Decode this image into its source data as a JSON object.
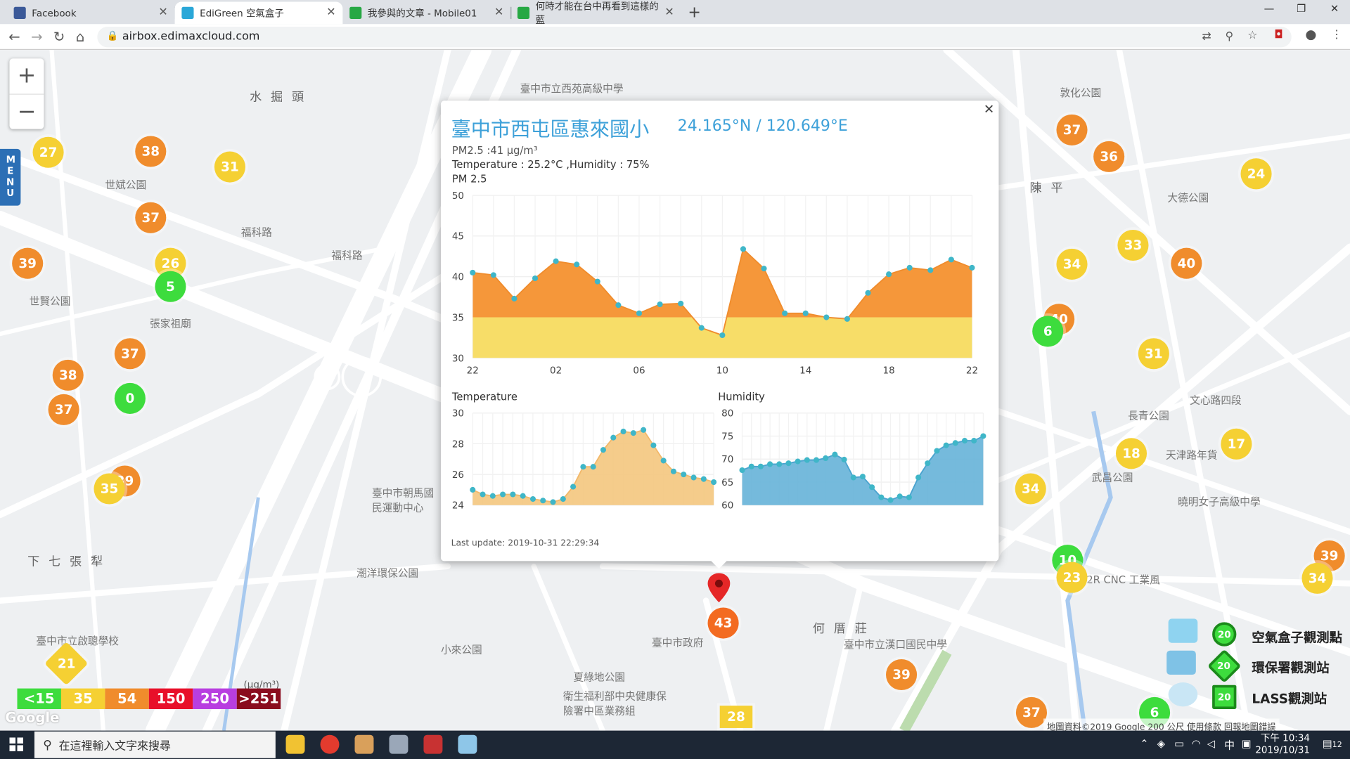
{
  "browser": {
    "tabs": [
      {
        "label": "Facebook",
        "color": "#3b5998",
        "active": false
      },
      {
        "label": "EdiGreen 空氣盒子",
        "color": "#2aa7d8",
        "active": true
      },
      {
        "label": "我參與的文章 - Mobile01",
        "color": "#27a844",
        "active": false
      },
      {
        "label": "何時才能在台中再看到這樣的藍",
        "color": "#27a844",
        "active": false
      }
    ],
    "url": "airbox.edimaxcloud.com"
  },
  "map": {
    "labels": [
      "水 掘 頭",
      "世賢公園",
      "世斌公園",
      "張家祖廟",
      "福科路",
      "福科路",
      "下 七 張 犁",
      "潮洋環保公園",
      "臺中市政府",
      "何 厝 莊",
      "臺中市立漢口國民中學",
      "夏綠地公園",
      "小來公園",
      "陳 平",
      "敦化公園",
      "大德公園",
      "長青公園",
      "天津路年貨",
      "曉明女子高級中學",
      "2R CNC 工業風",
      "武昌公園",
      "文心路四段",
      "臺中市立西苑高級中學",
      "臺中市朝馬國民運動中心",
      "臺中市立啟聰學校",
      "衛生福利部中央健康保險署中區業務組"
    ],
    "stations": [
      {
        "value": "27",
        "c": "y"
      },
      {
        "value": "38",
        "c": "o"
      },
      {
        "value": "31",
        "c": "y"
      },
      {
        "value": "37",
        "c": "o"
      },
      {
        "value": "39",
        "c": "o"
      },
      {
        "value": "26",
        "c": "y"
      },
      {
        "value": "5",
        "c": "g"
      },
      {
        "value": "37",
        "c": "o"
      },
      {
        "value": "38",
        "c": "o"
      },
      {
        "value": "37",
        "c": "o"
      },
      {
        "value": "0",
        "c": "g"
      },
      {
        "value": "39",
        "c": "o"
      },
      {
        "value": "35",
        "c": "y"
      },
      {
        "value": "37",
        "c": "o"
      },
      {
        "value": "36",
        "c": "o"
      },
      {
        "value": "24",
        "c": "y"
      },
      {
        "value": "33",
        "c": "y"
      },
      {
        "value": "34",
        "c": "y"
      },
      {
        "value": "40",
        "c": "o"
      },
      {
        "value": "40",
        "c": "o"
      },
      {
        "value": "6",
        "c": "g"
      },
      {
        "value": "31",
        "c": "y"
      },
      {
        "value": "17",
        "c": "y"
      },
      {
        "value": "18",
        "c": "y"
      },
      {
        "value": "34",
        "c": "y"
      },
      {
        "value": "10",
        "c": "g"
      },
      {
        "value": "23",
        "c": "y"
      },
      {
        "value": "39",
        "c": "o"
      },
      {
        "value": "34",
        "c": "y"
      },
      {
        "value": "43",
        "c": "o"
      },
      {
        "value": "39",
        "c": "o"
      },
      {
        "value": "37",
        "c": "o"
      },
      {
        "value": "6",
        "c": "g"
      },
      {
        "value": "21",
        "c": "y"
      },
      {
        "value": "28",
        "c": "y"
      }
    ],
    "legend": [
      {
        "label": "<15",
        "color": "#3ddc3d"
      },
      {
        "label": "35",
        "color": "#f5d033"
      },
      {
        "label": "54",
        "color": "#f08c2c"
      },
      {
        "label": "150",
        "color": "#e8102a"
      },
      {
        "label": "250",
        "color": "#b83ee0"
      },
      {
        "label": ">251",
        "color": "#8a0c1e"
      }
    ],
    "legend_unit": "(μg/m³)",
    "station_types": [
      {
        "label": "空氣盒子觀測點",
        "badge": "20"
      },
      {
        "label": "環保署觀測站",
        "badge": "20"
      },
      {
        "label": "LASS觀測站",
        "badge": "20"
      }
    ],
    "attribution": "地圖資料©2019 Google   200 公尺   使用條款   回報地圖錯誤",
    "menu_label": "MENU"
  },
  "popup": {
    "title": "臺中市西屯區惠來國小",
    "coords": "24.165°N / 120.649°E",
    "pm_line": "PM2.5 :41 μg/m³",
    "env_line": "Temperature : 25.2°C ,Humidity : 75%",
    "chart_title": "PM 2.5",
    "temp_title": "Temperature",
    "hum_title": "Humidity",
    "last_update": "Last update: 2019-10-31 22:29:34"
  },
  "chart_data": [
    {
      "type": "area",
      "title": "PM 2.5",
      "x": [
        "22",
        "23",
        "00",
        "01",
        "02",
        "03",
        "04",
        "05",
        "06",
        "07",
        "08",
        "09",
        "10",
        "11",
        "12",
        "13",
        "14",
        "15",
        "16",
        "17",
        "18",
        "19",
        "20",
        "21",
        "22"
      ],
      "xticks": [
        "22",
        "02",
        "06",
        "10",
        "14",
        "18",
        "22"
      ],
      "values": [
        40.5,
        40.2,
        37.3,
        39.8,
        41.9,
        41.5,
        39.4,
        36.5,
        35.5,
        36.6,
        36.7,
        33.7,
        32.8,
        43.4,
        41.0,
        35.5,
        35.5,
        35.0,
        34.8,
        38.0,
        40.3,
        41.1,
        40.8,
        42.1,
        41.1
      ],
      "ylim": [
        30,
        50
      ],
      "yticks": [
        30,
        35,
        40,
        45,
        50
      ],
      "grid": true
    },
    {
      "type": "area",
      "title": "Temperature",
      "values": [
        25.0,
        24.7,
        24.6,
        24.7,
        24.7,
        24.6,
        24.4,
        24.3,
        24.2,
        24.4,
        25.2,
        26.5,
        26.5,
        27.6,
        28.4,
        28.8,
        28.7,
        28.9,
        27.9,
        26.9,
        26.2,
        26.0,
        25.8,
        25.7,
        25.5
      ],
      "ylim": [
        24,
        30
      ],
      "yticks": [
        24,
        26,
        28,
        30
      ],
      "grid": true
    },
    {
      "type": "area",
      "title": "Humidity",
      "values": [
        67.6,
        68.4,
        68.4,
        68.9,
        68.9,
        69.1,
        69.5,
        69.8,
        69.8,
        70.2,
        71.0,
        69.9,
        66.0,
        66.2,
        63.9,
        61.7,
        61.1,
        61.9,
        61.7,
        66.0,
        69.1,
        71.8,
        73.0,
        73.5,
        74.0,
        74.0,
        75.0
      ],
      "ylim": [
        60,
        80
      ],
      "yticks": [
        60,
        65,
        70,
        75,
        80
      ],
      "grid": true
    }
  ],
  "taskbar": {
    "search_placeholder": "在這裡輸入文字來搜尋",
    "time": "下午 10:34",
    "date": "2019/10/31",
    "ime": "中",
    "notif": "12"
  }
}
